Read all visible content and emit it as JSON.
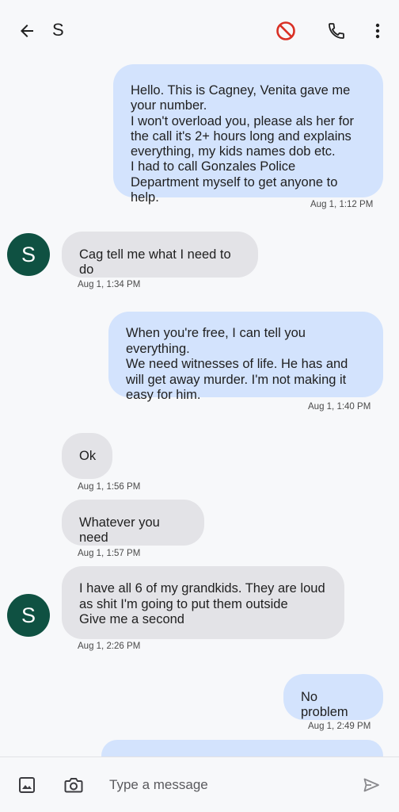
{
  "header": {
    "contact_name": "S",
    "icons": [
      "back-arrow-icon",
      "block-icon",
      "phone-icon",
      "more-vert-icon"
    ],
    "block_color": "#d93025"
  },
  "messages": [
    {
      "direction": "sent",
      "text": "Hello. This is Cagney, Venita gave me your number.\nI won't overload you, please als her for the call it's 2+ hours long and explains everything, my kids names dob etc.\nI had to call Gonzales Police Department myself to get anyone to help.",
      "timestamp": "Aug 1, 1:12 PM"
    },
    {
      "direction": "received",
      "text": "Cag tell me what I need to do",
      "timestamp": "Aug 1, 1:34 PM"
    },
    {
      "direction": "sent",
      "text": "When you're free, I can tell you everything.\nWe need witnesses of life. He has and will get away murder. I'm not making it easy for him.",
      "timestamp": "Aug 1, 1:40 PM"
    },
    {
      "direction": "received",
      "text": "Ok",
      "timestamp": "Aug 1, 1:56 PM"
    },
    {
      "direction": "received",
      "text": "Whatever you need",
      "timestamp": "Aug 1, 1:57 PM"
    },
    {
      "direction": "received",
      "text": "I have all 6 of my grandkids. They are loud as shit I'm going to put them outside\nGive me a second",
      "timestamp": "Aug 1, 2:26 PM"
    },
    {
      "direction": "sent",
      "text": "No problem",
      "timestamp": "Aug 1, 2:49 PM"
    }
  ],
  "avatar": {
    "initial": "S",
    "color": "#0f5142"
  },
  "colors": {
    "sent_bubble": "#d3e3fd",
    "received_bubble": "#e3e3e7",
    "background": "#f7f8fa"
  },
  "compose": {
    "placeholder": "Type a message",
    "value": "",
    "icons": [
      "gallery-icon",
      "camera-icon",
      "send-icon"
    ]
  }
}
